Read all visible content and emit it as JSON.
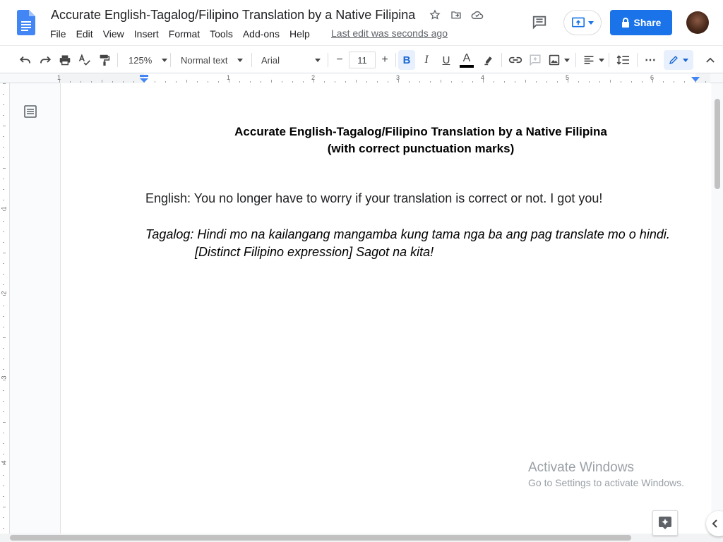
{
  "document": {
    "title": "Accurate English-Tagalog/Filipino Translation by a Native Filipina",
    "last_edit": "Last edit was seconds ago"
  },
  "menu": [
    "File",
    "Edit",
    "View",
    "Insert",
    "Format",
    "Tools",
    "Add-ons",
    "Help"
  ],
  "header": {
    "share_label": "Share"
  },
  "toolbar": {
    "zoom": "125%",
    "style": "Normal text",
    "font": "Arial",
    "font_size": "11",
    "minus": "−",
    "plus": "+",
    "bold": "B",
    "italic": "I",
    "underline": "U",
    "text_color": "A",
    "more": "⋯"
  },
  "ruler": {
    "numbers": [
      "1",
      "1",
      "2",
      "3",
      "4",
      "5",
      "6"
    ]
  },
  "vruler": {
    "numbers": [
      "1",
      "2",
      "3",
      "4"
    ]
  },
  "content": {
    "heading_line1": "Accurate English-Tagalog/Filipino Translation by a Native Filipina",
    "heading_line2": "(with correct punctuation marks)",
    "english": "English: You no longer have to worry if your translation is correct or not. I got you!",
    "tagalog_line1": "Tagalog: Hindi mo na kailangang mangamba kung tama nga ba ang pag translate mo o hindi.",
    "tagalog_line2": "[Distinct Filipino expression] Sagot na kita!"
  },
  "watermark": {
    "line1": "Activate Windows",
    "line2": "Go to Settings to activate Windows."
  },
  "colors": {
    "accent": "#1a73e8",
    "doc_blue": "#4285f4"
  }
}
